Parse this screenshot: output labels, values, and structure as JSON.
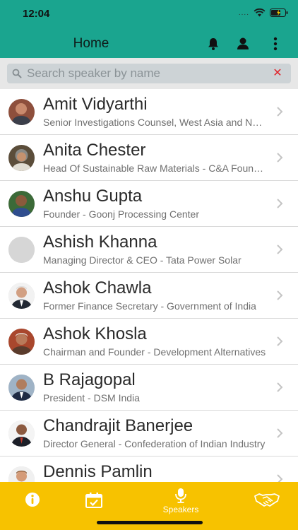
{
  "status_bar": {
    "time": "12:04",
    "signal": "...."
  },
  "header": {
    "title": "Home"
  },
  "icons": {
    "bell": "bell-icon",
    "user": "user-icon",
    "more": "more-vertical-icon",
    "search": "search-icon",
    "clear": "close-icon"
  },
  "search": {
    "placeholder": "Search speaker by name",
    "value": "",
    "clear_symbol": "✕"
  },
  "speakers": [
    {
      "name": "Amit Vidyarthi",
      "title": "Senior Investigations Counsel, West Asia and North Africa"
    },
    {
      "name": "Anita Chester",
      "title": "Head Of Sustainable Raw Materials - C&A Foundation"
    },
    {
      "name": "Anshu Gupta",
      "title": "Founder - Goonj Processing Center"
    },
    {
      "name": "Ashish Khanna",
      "title": "Managing Director & CEO - Tata Power Solar"
    },
    {
      "name": "Ashok Chawla",
      "title": "Former Finance Secretary - Government of India"
    },
    {
      "name": "Ashok Khosla",
      "title": "Chairman and Founder - Development Alternatives"
    },
    {
      "name": "B Rajagopal",
      "title": "President - DSM India"
    },
    {
      "name": "Chandrajit Banerjee",
      "title": "Director General - Confederation of Indian Industry"
    },
    {
      "name": "Dennis Pamlin",
      "title": ""
    }
  ],
  "tabs": [
    {
      "label": "",
      "icon": "info-icon"
    },
    {
      "label": "",
      "icon": "calendar-check-icon"
    },
    {
      "label": "Speakers",
      "icon": "microphone-icon"
    },
    {
      "label": "",
      "icon": "handshake-icon"
    }
  ],
  "colors": {
    "header": "#1aa58f",
    "tabbar": "#f7c200",
    "clear": "#e0242b"
  }
}
